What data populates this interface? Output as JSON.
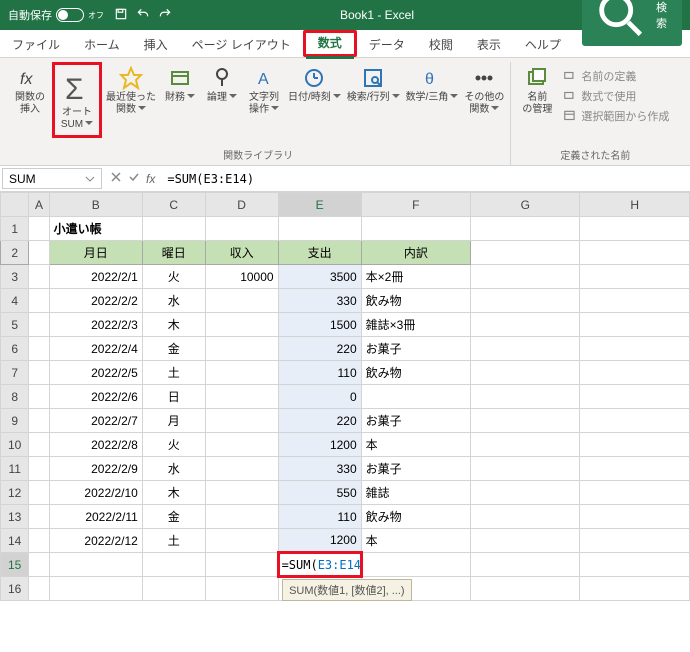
{
  "titlebar": {
    "autosave": "自動保存",
    "autosave_state": "オフ",
    "doc": "Book1 - Excel",
    "search": "検索"
  },
  "tabs": {
    "file": "ファイル",
    "home": "ホーム",
    "insert": "挿入",
    "page": "ページ レイアウト",
    "formula": "数式",
    "data": "データ",
    "review": "校閲",
    "view": "表示",
    "help": "ヘルプ"
  },
  "ribbon": {
    "fx": "関数の\n挿入",
    "autosum": "オート\nSUM",
    "recent": "最近使った\n関数",
    "finance": "財務",
    "logic": "論理",
    "text": "文字列\n操作",
    "datetime": "日付/時刻",
    "lookup": "検索/行列",
    "math": "数学/三角",
    "other": "その他の\n関数",
    "group_lib": "関数ライブラリ",
    "name_mgr": "名前\nの管理",
    "def_name": "名前の定義",
    "use_formula": "数式で使用",
    "from_sel": "選択範囲から作成",
    "group_names": "定義された名前"
  },
  "formula_bar": {
    "name_box": "SUM",
    "formula": "=SUM(E3:E14)"
  },
  "columns": [
    "A",
    "B",
    "C",
    "D",
    "E",
    "F",
    "G",
    "H"
  ],
  "sheet_title": "小遣い帳",
  "headers": {
    "date": "月日",
    "day": "曜日",
    "income": "収入",
    "expense": "支出",
    "detail": "内訳"
  },
  "rows": [
    {
      "r": 3,
      "date": "2022/2/1",
      "day": "火",
      "income": "10000",
      "expense": "3500",
      "detail": "本×2冊"
    },
    {
      "r": 4,
      "date": "2022/2/2",
      "day": "水",
      "income": "",
      "expense": "330",
      "detail": "飲み物"
    },
    {
      "r": 5,
      "date": "2022/2/3",
      "day": "木",
      "income": "",
      "expense": "1500",
      "detail": "雑誌×3冊"
    },
    {
      "r": 6,
      "date": "2022/2/4",
      "day": "金",
      "income": "",
      "expense": "220",
      "detail": "お菓子"
    },
    {
      "r": 7,
      "date": "2022/2/5",
      "day": "土",
      "income": "",
      "expense": "110",
      "detail": "飲み物"
    },
    {
      "r": 8,
      "date": "2022/2/6",
      "day": "日",
      "income": "",
      "expense": "0",
      "detail": ""
    },
    {
      "r": 9,
      "date": "2022/2/7",
      "day": "月",
      "income": "",
      "expense": "220",
      "detail": "お菓子"
    },
    {
      "r": 10,
      "date": "2022/2/8",
      "day": "火",
      "income": "",
      "expense": "1200",
      "detail": "本"
    },
    {
      "r": 11,
      "date": "2022/2/9",
      "day": "水",
      "income": "",
      "expense": "330",
      "detail": "お菓子"
    },
    {
      "r": 12,
      "date": "2022/2/10",
      "day": "木",
      "income": "",
      "expense": "550",
      "detail": "雑誌"
    },
    {
      "r": 13,
      "date": "2022/2/11",
      "day": "金",
      "income": "",
      "expense": "110",
      "detail": "飲み物"
    },
    {
      "r": 14,
      "date": "2022/2/12",
      "day": "土",
      "income": "",
      "expense": "1200",
      "detail": "本"
    }
  ],
  "active_formula": {
    "pre": "=SUM(",
    "ref": "E3:E14",
    "post": ")"
  },
  "hint": "SUM(数値1, [数値2], ...)"
}
